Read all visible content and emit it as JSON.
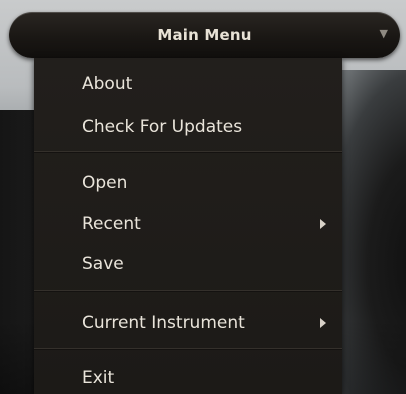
{
  "menu_bar": {
    "title": "Main Menu",
    "arrow_icon": "chevron-down-icon"
  },
  "dropdown": {
    "items": [
      {
        "label": "About",
        "has_submenu": false
      },
      {
        "label": "Check For Updates",
        "has_submenu": false
      },
      {
        "label": "Open",
        "has_submenu": false
      },
      {
        "label": "Recent",
        "has_submenu": true
      },
      {
        "label": "Save",
        "has_submenu": false
      },
      {
        "label": "Current Instrument",
        "has_submenu": true
      },
      {
        "label": "Exit",
        "has_submenu": false
      }
    ]
  },
  "colors": {
    "menu_background": "#1c1a17",
    "menu_text": "#e9e4da",
    "bar_title": "#e8e2d6"
  }
}
